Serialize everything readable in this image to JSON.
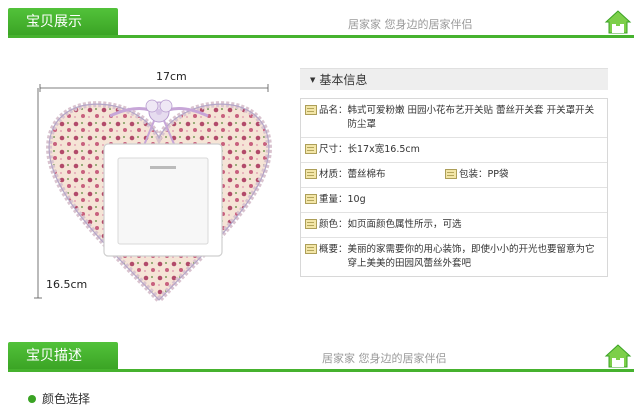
{
  "section1": {
    "title": "宝贝展示",
    "slogan": "居家家 您身边的居家伴侣"
  },
  "product_image": {
    "width_label": "17cm",
    "height_label": "16.5cm"
  },
  "info": {
    "header": "基本信息",
    "rows": [
      {
        "key": "品名：",
        "value": "韩式可爱粉嫩 田园小花布艺开关贴 蕾丝开关套 开关罩开关防尘罩"
      },
      {
        "key": "尺寸：",
        "value": "长17x宽16.5cm"
      },
      {
        "key": "材质：",
        "value": "蕾丝棉布",
        "key2": "包装：",
        "value2": "PP袋"
      },
      {
        "key": "重量：",
        "value": "10g"
      },
      {
        "key": "颜色：",
        "value": "如页面颜色属性所示，可选"
      },
      {
        "key": "概要：",
        "value": "美丽的家需要你的用心装饰，即使小小的开光也要留意为它穿上美美的田园风蕾丝外套吧"
      }
    ]
  },
  "section2": {
    "title": "宝贝描述",
    "slogan": "居家家 您身边的居家伴侣"
  },
  "color_select": {
    "label": "颜色选择"
  },
  "colors": {
    "accent": "#46b22e",
    "tab": "#3aa324"
  }
}
